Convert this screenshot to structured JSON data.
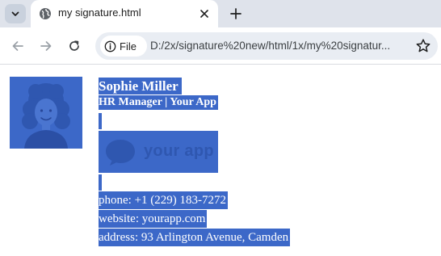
{
  "browser": {
    "tab_title": "my signature.html",
    "address_scheme_label": "File",
    "url": "D:/2x/signature%20new/html/1x/my%20signatur..."
  },
  "signature": {
    "name": "Sophie Miller",
    "role": "HR Manager | Your App",
    "logo_text": "your app",
    "phone": "phone: +1 (229) 183-7272",
    "website": "website: yourapp.com",
    "address": "address: 93 Arlington Avenue, Camden"
  },
  "colors": {
    "selection": "#3c68c8",
    "tabstrip": "#dfe3eb",
    "omnibox": "#e9edf3"
  },
  "icons": {
    "tab_list": "chevron-down-icon",
    "tab": "globe-icon",
    "close": "close-icon",
    "new_tab": "plus-icon",
    "back": "arrow-left-icon",
    "forward": "arrow-right-icon",
    "reload": "reload-icon",
    "info": "info-icon",
    "bookmark": "star-icon",
    "logo": "chat-bubble-icon"
  }
}
